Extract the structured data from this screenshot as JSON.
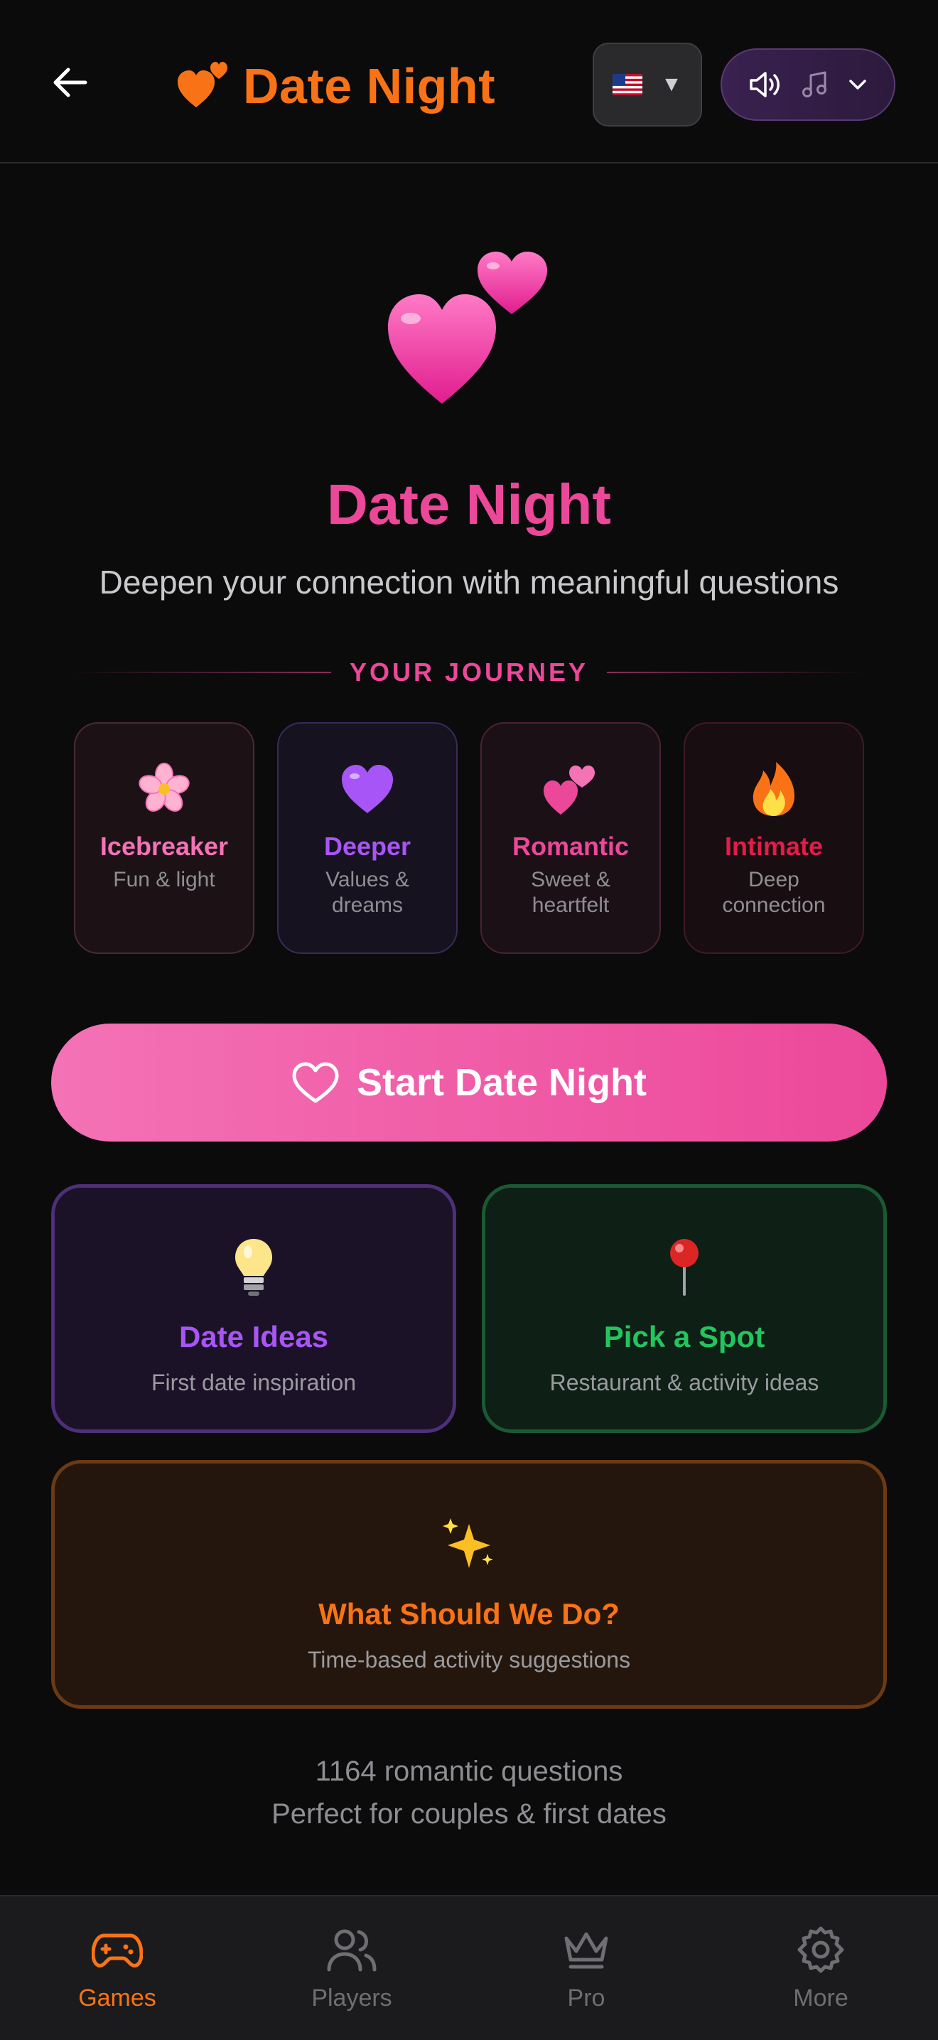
{
  "header": {
    "title": "Date Night",
    "brand_color": "#f97316",
    "back_icon": "arrow-left-icon",
    "language": {
      "icon": "us-flag-icon",
      "caret": "▼"
    },
    "audio": {
      "sound_icon": "speaker-icon",
      "music_icon": "music-note-icon",
      "chevron_icon": "chevron-down-icon"
    }
  },
  "hero": {
    "icon": "two-hearts-icon",
    "title": "Date Night",
    "subtitle": "Deepen your connection with meaningful questions"
  },
  "journey": {
    "label": "YOUR JOURNEY",
    "stages": [
      {
        "name": "Icebreaker",
        "desc": "Fun & light",
        "icon": "cherry-blossom-icon",
        "color": "#f472b6"
      },
      {
        "name": "Deeper",
        "desc": "Values & dreams",
        "icon": "purple-heart-icon",
        "color": "#a855f7"
      },
      {
        "name": "Romantic",
        "desc": "Sweet & heartfelt",
        "icon": "two-hearts-icon",
        "color": "#ec4899"
      },
      {
        "name": "Intimate",
        "desc": "Deep connection",
        "icon": "fire-icon",
        "color": "#e11d48"
      }
    ]
  },
  "start_button": {
    "label": "Start Date Night",
    "icon": "heart-outline-icon"
  },
  "cards": {
    "ideas": {
      "title": "Date Ideas",
      "subtitle": "First date inspiration",
      "icon": "lightbulb-icon",
      "color": "#a855f7"
    },
    "spot": {
      "title": "Pick a Spot",
      "subtitle": "Restaurant & activity ideas",
      "icon": "pushpin-icon",
      "color": "#22c55e"
    },
    "what": {
      "title": "What Should We Do?",
      "subtitle": "Time-based activity suggestions",
      "icon": "sparkles-icon",
      "color": "#f97316"
    }
  },
  "footer": {
    "line1": "1164 romantic questions",
    "line2": "Perfect for couples & first dates"
  },
  "tabbar": {
    "tabs": [
      {
        "label": "Games",
        "icon": "gamepad-icon",
        "active": true
      },
      {
        "label": "Players",
        "icon": "users-icon",
        "active": false
      },
      {
        "label": "Pro",
        "icon": "crown-icon",
        "active": false
      },
      {
        "label": "More",
        "icon": "gear-icon",
        "active": false
      }
    ]
  }
}
